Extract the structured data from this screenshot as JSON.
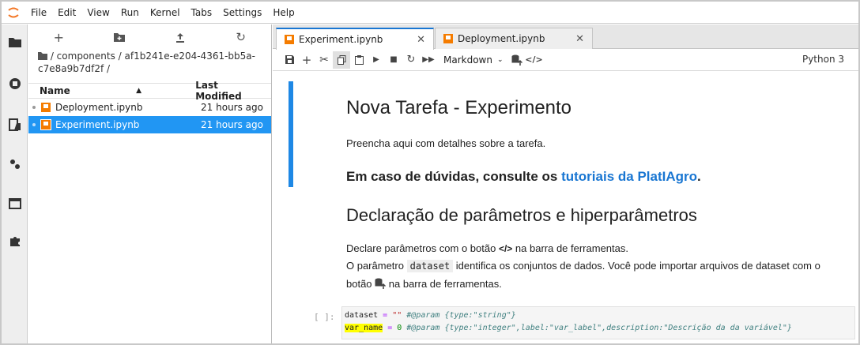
{
  "menubar": {
    "items": [
      "File",
      "Edit",
      "View",
      "Run",
      "Kernel",
      "Tabs",
      "Settings",
      "Help"
    ]
  },
  "file_browser": {
    "breadcrumb": "/ components / af1b241e-e204-4361-bb5a-c7e8a9b7df2f /",
    "columns": {
      "name": "Name",
      "modified": "Last Modified"
    },
    "files": [
      {
        "name": "Deployment.ipynb",
        "modified": "21 hours ago"
      },
      {
        "name": "Experiment.ipynb",
        "modified": "21 hours ago"
      }
    ]
  },
  "tabs": [
    {
      "label": "Experiment.ipynb",
      "close": "✕"
    },
    {
      "label": "Deployment.ipynb",
      "close": "✕"
    }
  ],
  "toolbar": {
    "cell_type": "Markdown",
    "kernel": "Python 3"
  },
  "notebook": {
    "title": "Nova Tarefa - Experimento",
    "intro": "Preencha aqui com detalhes sobre a tarefa.",
    "doubts_prefix": "Em caso de dúvidas, consulte os ",
    "doubts_link": "tutoriais da PlatIAgro",
    "doubts_suffix": ".",
    "section_title": "Declaração de parâmetros e hiperparâmetros",
    "para1_a": "Declare parâmetros com o botão ",
    "para1_b": " na barra de ferramentas.",
    "para2_a": "O parâmetro ",
    "para2_code": "dataset",
    "para2_b": " identifica os conjuntos de dados. Você pode importar arquivos de dataset com o",
    "para3_a": "botão ",
    "para3_b": " na barra de ferramentas.",
    "prompt": "[ ]:",
    "code_line1": {
      "var": "dataset",
      "op": " = ",
      "str": "\"\"",
      "comment": " #@param {type:\"string\"}"
    },
    "code_line2": {
      "var": "var_name",
      "op": " = ",
      "num": "0",
      "comment": " #@param {type:\"integer\",label:\"var_label\",description:\"Descrição da da variável\"}"
    }
  },
  "colors": {
    "accent": "#2196f3",
    "notebook_icon": "#f57c00",
    "collapser": "#1e88e5",
    "link": "#1976d2",
    "highlight": "#ffff00"
  }
}
